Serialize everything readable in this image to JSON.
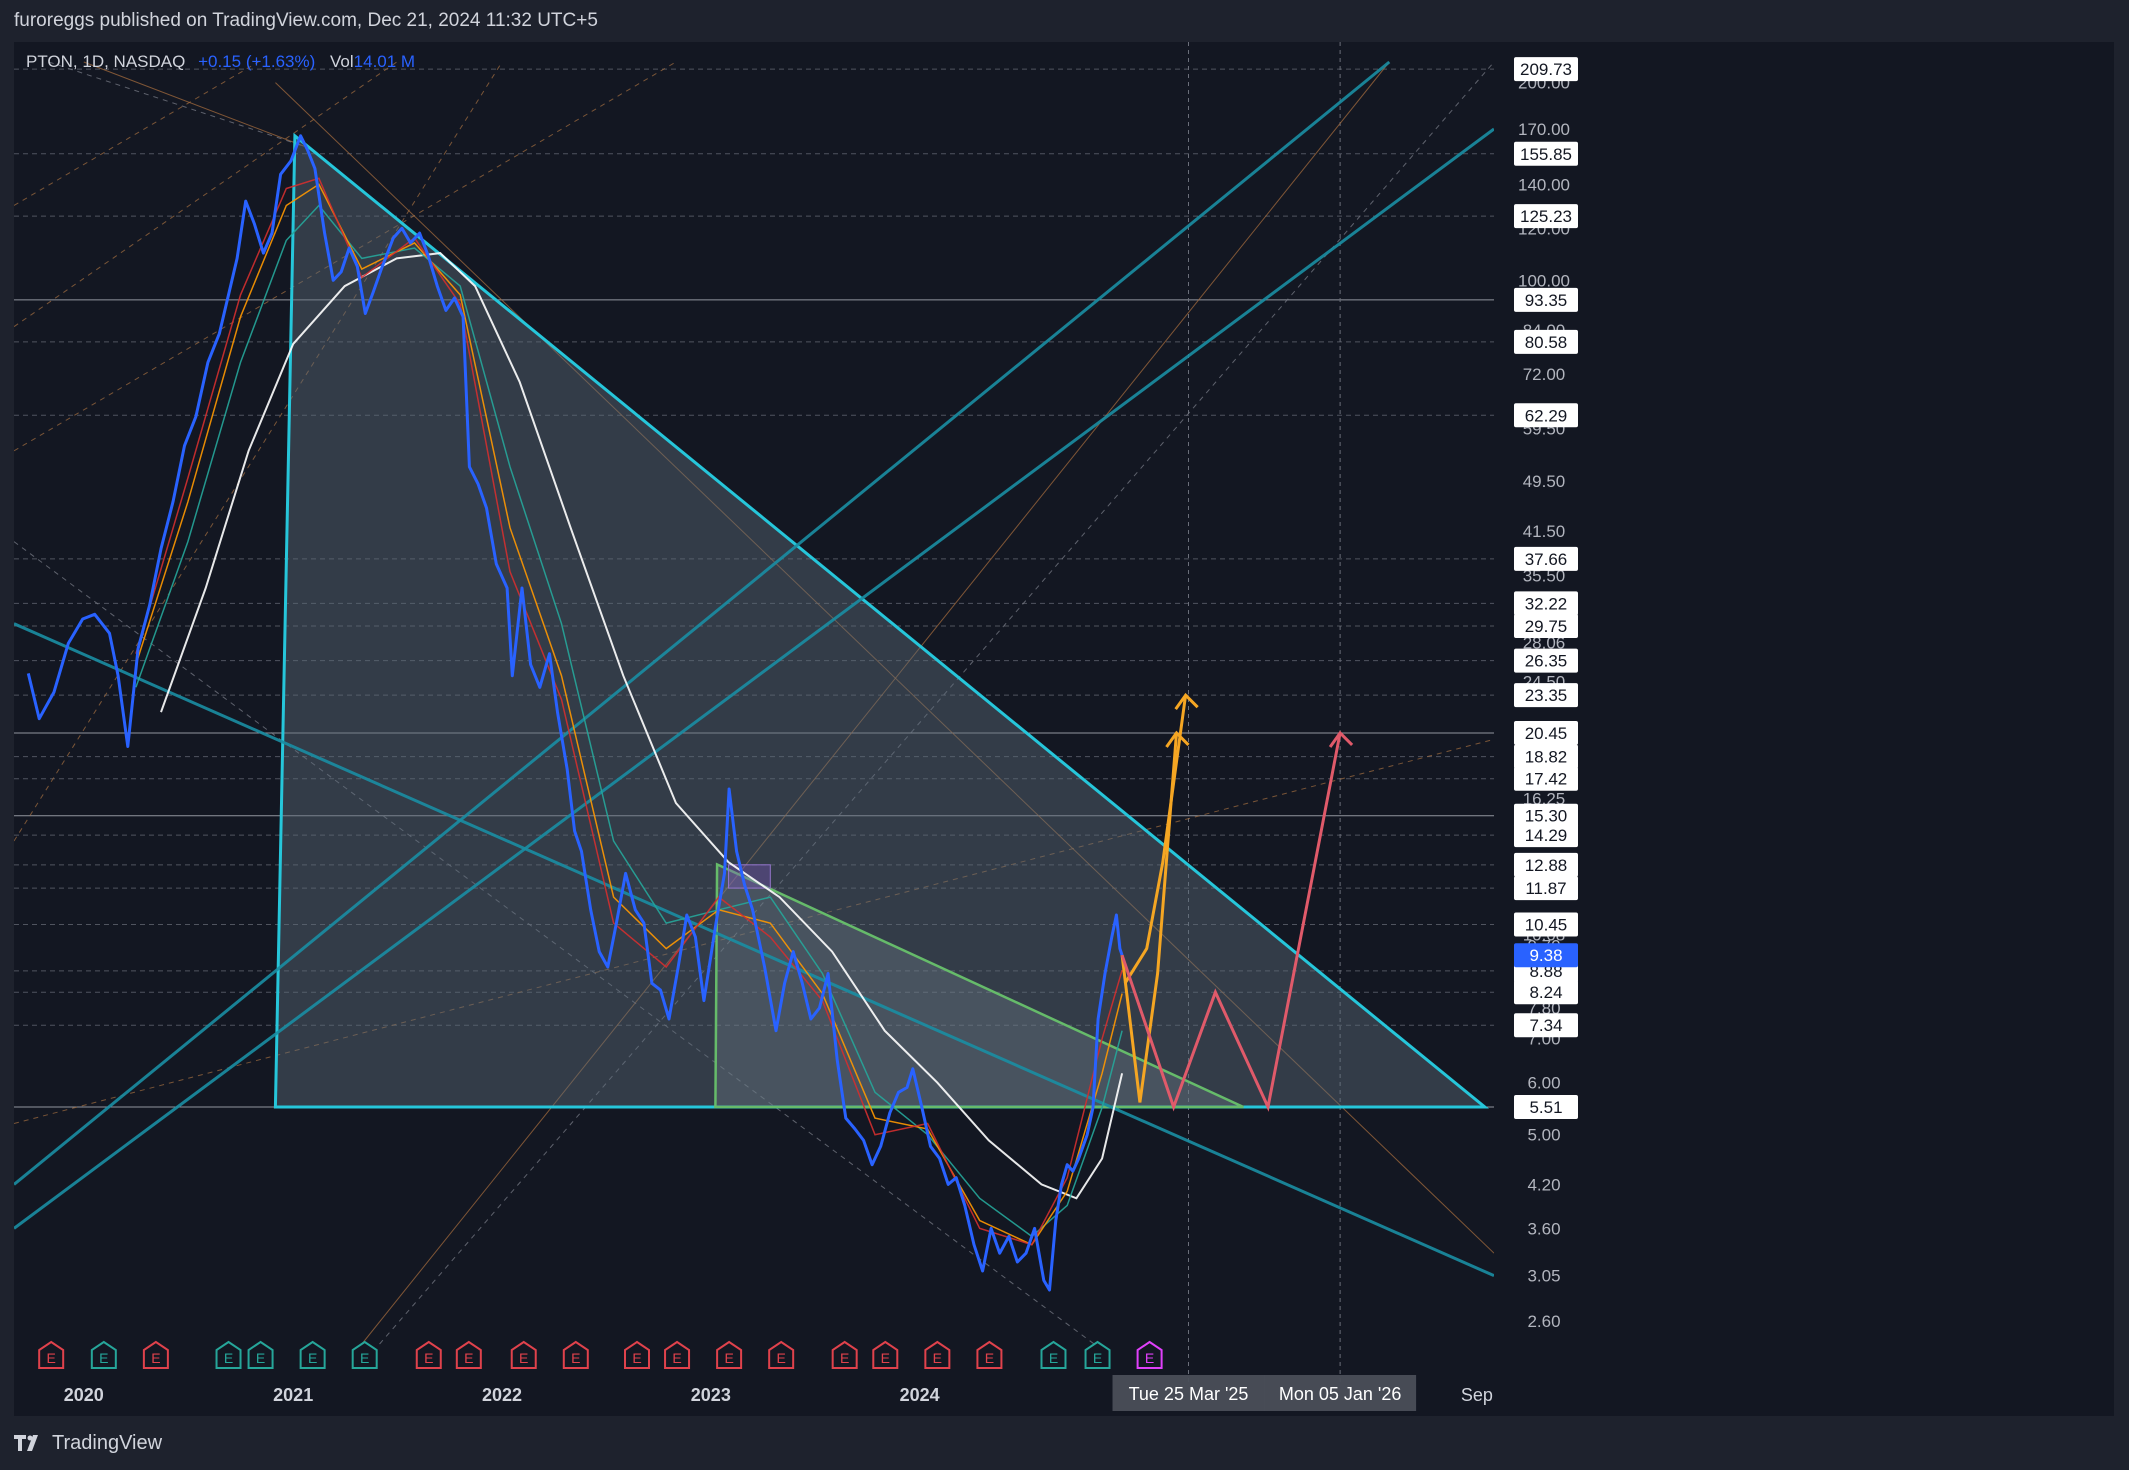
{
  "header": {
    "published": "furoreggs published on TradingView.com, Dec 21, 2024 11:32 UTC+5"
  },
  "legend": {
    "symbol": "PTON, 1D, NASDAQ",
    "change": "+0.15 (+1.63%)",
    "vol_label": "Vol",
    "vol_value": "14.01 M"
  },
  "footer": {
    "brand": "TradingView"
  },
  "colors": {
    "background": "#131722",
    "price": "#2962ff",
    "triangle": "#26c6da",
    "projection_up": "#f5a623",
    "projection_down": "#e05a6a",
    "earnings_red": "#e0424c",
    "earnings_green": "#26a69a",
    "earnings_purple": "#e040fb",
    "ma_white": "#ffffff",
    "ma_teal": "#26a69a",
    "ma_orange": "#ff9800",
    "ma_red": "#d32f2f"
  },
  "chart_data": {
    "type": "line",
    "symbol": "PTON",
    "interval": "1D",
    "y_scale": "log",
    "ylim": [
      2.4,
      215
    ],
    "x_range": [
      "2019-09-01",
      "2026-10-01"
    ],
    "x_tick_labels": [
      {
        "label": "2020",
        "date": "2020-01-01"
      },
      {
        "label": "2021",
        "date": "2021-01-01"
      },
      {
        "label": "2022",
        "date": "2022-01-01"
      },
      {
        "label": "2023",
        "date": "2023-01-01"
      },
      {
        "label": "2024",
        "date": "2024-01-01"
      },
      {
        "label": "Sep",
        "date": "2026-09-01"
      }
    ],
    "y_ticks": [
      200.0,
      170.0,
      140.0,
      120.0,
      100.0,
      84.0,
      72.0,
      59.5,
      49.5,
      41.5,
      35.5,
      28.06,
      24.5,
      16.25,
      10.08,
      9.7,
      7.8,
      7.0,
      6.0,
      5.0,
      4.2,
      3.6,
      3.05,
      2.6
    ],
    "y_level_labels": [
      209.73,
      155.85,
      125.23,
      93.35,
      80.58,
      62.29,
      37.66,
      32.22,
      29.75,
      26.35,
      23.35,
      20.45,
      18.82,
      17.42,
      15.3,
      14.29,
      12.88,
      11.87,
      10.45,
      8.88,
      8.24,
      7.34,
      5.51
    ],
    "current_price": 9.38,
    "date_badges": [
      "Tue 25 Mar '25",
      "Mon 05 Jan '26"
    ],
    "price_series": [
      [
        "2019-09-26",
        25.2
      ],
      [
        "2019-10-15",
        21.5
      ],
      [
        "2019-11-10",
        23.6
      ],
      [
        "2019-12-05",
        28.0
      ],
      [
        "2019-12-30",
        30.5
      ],
      [
        "2020-01-20",
        31.0
      ],
      [
        "2020-02-15",
        29.0
      ],
      [
        "2020-03-01",
        25.0
      ],
      [
        "2020-03-18",
        19.5
      ],
      [
        "2020-04-05",
        27.5
      ],
      [
        "2020-04-25",
        32.0
      ],
      [
        "2020-05-15",
        39.0
      ],
      [
        "2020-06-05",
        46.0
      ],
      [
        "2020-06-25",
        56.0
      ],
      [
        "2020-07-15",
        62.0
      ],
      [
        "2020-08-05",
        75.0
      ],
      [
        "2020-08-25",
        83.0
      ],
      [
        "2020-09-10",
        95.0
      ],
      [
        "2020-09-25",
        108.0
      ],
      [
        "2020-10-10",
        132.0
      ],
      [
        "2020-10-25",
        122.0
      ],
      [
        "2020-11-10",
        110.0
      ],
      [
        "2020-11-25",
        118.0
      ],
      [
        "2020-12-10",
        145.0
      ],
      [
        "2020-12-28",
        152.0
      ],
      [
        "2021-01-14",
        166.0
      ],
      [
        "2021-01-26",
        158.0
      ],
      [
        "2021-02-08",
        148.0
      ],
      [
        "2021-02-25",
        118.0
      ],
      [
        "2021-03-12",
        100.0
      ],
      [
        "2021-03-26",
        103.0
      ],
      [
        "2021-04-09",
        112.0
      ],
      [
        "2021-04-23",
        105.0
      ],
      [
        "2021-05-07",
        89.0
      ],
      [
        "2021-05-21",
        96.0
      ],
      [
        "2021-06-04",
        104.0
      ],
      [
        "2021-06-25",
        116.0
      ],
      [
        "2021-07-10",
        120.0
      ],
      [
        "2021-07-25",
        114.0
      ],
      [
        "2021-08-10",
        118.0
      ],
      [
        "2021-08-25",
        109.0
      ],
      [
        "2021-09-10",
        98.0
      ],
      [
        "2021-09-25",
        90.0
      ],
      [
        "2021-10-10",
        94.0
      ],
      [
        "2021-10-25",
        88.0
      ],
      [
        "2021-11-05",
        52.0
      ],
      [
        "2021-11-20",
        49.0
      ],
      [
        "2021-12-05",
        45.0
      ],
      [
        "2021-12-22",
        37.0
      ],
      [
        "2022-01-10",
        34.0
      ],
      [
        "2022-01-19",
        25.0
      ],
      [
        "2022-02-05",
        34.0
      ],
      [
        "2022-02-20",
        26.0
      ],
      [
        "2022-03-08",
        24.0
      ],
      [
        "2022-03-25",
        27.0
      ],
      [
        "2022-04-08",
        22.0
      ],
      [
        "2022-04-25",
        18.0
      ],
      [
        "2022-05-08",
        14.5
      ],
      [
        "2022-05-20",
        13.5
      ],
      [
        "2022-06-05",
        11.0
      ],
      [
        "2022-06-20",
        9.5
      ],
      [
        "2022-07-05",
        9.0
      ],
      [
        "2022-07-20",
        10.5
      ],
      [
        "2022-08-05",
        12.5
      ],
      [
        "2022-08-22",
        11.0
      ],
      [
        "2022-09-06",
        10.5
      ],
      [
        "2022-09-20",
        8.5
      ],
      [
        "2022-10-05",
        8.3
      ],
      [
        "2022-10-20",
        7.5
      ],
      [
        "2022-11-05",
        9.0
      ],
      [
        "2022-11-20",
        10.8
      ],
      [
        "2022-12-05",
        10.0
      ],
      [
        "2022-12-20",
        8.0
      ],
      [
        "2023-01-10",
        10.5
      ],
      [
        "2023-01-25",
        12.5
      ],
      [
        "2023-02-02",
        16.8
      ],
      [
        "2023-02-15",
        13.5
      ],
      [
        "2023-03-01",
        12.0
      ],
      [
        "2023-03-15",
        11.0
      ],
      [
        "2023-04-05",
        9.0
      ],
      [
        "2023-04-25",
        7.2
      ],
      [
        "2023-05-10",
        8.5
      ],
      [
        "2023-05-25",
        9.5
      ],
      [
        "2023-06-10",
        8.5
      ],
      [
        "2023-06-25",
        7.5
      ],
      [
        "2023-07-10",
        7.8
      ],
      [
        "2023-07-25",
        8.8
      ],
      [
        "2023-08-10",
        6.5
      ],
      [
        "2023-08-25",
        5.3
      ],
      [
        "2023-09-10",
        5.1
      ],
      [
        "2023-09-25",
        4.9
      ],
      [
        "2023-10-10",
        4.5
      ],
      [
        "2023-10-25",
        4.8
      ],
      [
        "2023-11-10",
        5.4
      ],
      [
        "2023-11-25",
        5.8
      ],
      [
        "2023-12-10",
        5.9
      ],
      [
        "2023-12-20",
        6.3
      ],
      [
        "2024-01-05",
        5.5
      ],
      [
        "2024-01-20",
        4.8
      ],
      [
        "2024-02-05",
        4.6
      ],
      [
        "2024-02-20",
        4.2
      ],
      [
        "2024-03-05",
        4.3
      ],
      [
        "2024-03-20",
        3.9
      ],
      [
        "2024-04-05",
        3.4
      ],
      [
        "2024-04-20",
        3.1
      ],
      [
        "2024-05-05",
        3.6
      ],
      [
        "2024-05-20",
        3.3
      ],
      [
        "2024-06-05",
        3.5
      ],
      [
        "2024-06-20",
        3.2
      ],
      [
        "2024-07-05",
        3.3
      ],
      [
        "2024-07-20",
        3.6
      ],
      [
        "2024-08-05",
        3.0
      ],
      [
        "2024-08-15",
        2.9
      ],
      [
        "2024-08-26",
        3.7
      ],
      [
        "2024-09-05",
        4.2
      ],
      [
        "2024-09-15",
        4.5
      ],
      [
        "2024-09-25",
        4.4
      ],
      [
        "2024-10-05",
        4.6
      ],
      [
        "2024-10-20",
        5.0
      ],
      [
        "2024-10-30",
        5.5
      ],
      [
        "2024-11-08",
        7.5
      ],
      [
        "2024-11-20",
        8.8
      ],
      [
        "2024-12-02",
        10.0
      ],
      [
        "2024-12-10",
        10.8
      ],
      [
        "2024-12-16",
        9.6
      ],
      [
        "2024-12-20",
        9.38
      ]
    ],
    "ma_white": [
      [
        "2020-05-15",
        22.0
      ],
      [
        "2020-08-01",
        34.0
      ],
      [
        "2020-10-15",
        55.0
      ],
      [
        "2021-01-01",
        80.0
      ],
      [
        "2021-04-01",
        98.0
      ],
      [
        "2021-07-01",
        108.0
      ],
      [
        "2021-09-15",
        110.0
      ],
      [
        "2021-11-15",
        98.0
      ],
      [
        "2022-02-01",
        70.0
      ],
      [
        "2022-05-01",
        42.0
      ],
      [
        "2022-08-01",
        25.0
      ],
      [
        "2022-11-01",
        16.0
      ],
      [
        "2023-02-01",
        13.0
      ],
      [
        "2023-05-01",
        11.5
      ],
      [
        "2023-08-01",
        9.5
      ],
      [
        "2023-11-01",
        7.2
      ],
      [
        "2024-02-01",
        6.0
      ],
      [
        "2024-05-01",
        4.9
      ],
      [
        "2024-08-01",
        4.2
      ],
      [
        "2024-10-01",
        4.0
      ],
      [
        "2024-11-15",
        4.6
      ],
      [
        "2024-12-20",
        6.2
      ]
    ],
    "ma_teal": [
      [
        "2020-04-01",
        24.0
      ],
      [
        "2020-07-01",
        40.0
      ],
      [
        "2020-10-01",
        75.0
      ],
      [
        "2020-12-20",
        115.0
      ],
      [
        "2021-02-15",
        130.0
      ],
      [
        "2021-05-01",
        108.0
      ],
      [
        "2021-08-01",
        112.0
      ],
      [
        "2021-10-20",
        98.0
      ],
      [
        "2022-01-15",
        52.0
      ],
      [
        "2022-04-15",
        30.0
      ],
      [
        "2022-07-15",
        14.0
      ],
      [
        "2022-10-15",
        10.5
      ],
      [
        "2023-01-15",
        11.0
      ],
      [
        "2023-04-15",
        11.5
      ],
      [
        "2023-07-15",
        8.8
      ],
      [
        "2023-10-15",
        5.8
      ],
      [
        "2024-01-15",
        5.0
      ],
      [
        "2024-04-15",
        4.0
      ],
      [
        "2024-07-15",
        3.5
      ],
      [
        "2024-09-15",
        3.9
      ],
      [
        "2024-11-15",
        5.5
      ],
      [
        "2024-12-20",
        7.2
      ]
    ],
    "ma_orange": [
      [
        "2020-04-01",
        26.0
      ],
      [
        "2020-07-01",
        46.0
      ],
      [
        "2020-10-01",
        88.0
      ],
      [
        "2020-12-20",
        130.0
      ],
      [
        "2021-02-15",
        140.0
      ],
      [
        "2021-05-01",
        104.0
      ],
      [
        "2021-08-01",
        114.0
      ],
      [
        "2021-10-20",
        95.0
      ],
      [
        "2022-01-15",
        42.0
      ],
      [
        "2022-04-15",
        25.0
      ],
      [
        "2022-07-15",
        11.5
      ],
      [
        "2022-10-15",
        9.6
      ],
      [
        "2023-01-15",
        11.0
      ],
      [
        "2023-04-15",
        10.5
      ],
      [
        "2023-07-15",
        8.2
      ],
      [
        "2023-10-15",
        5.3
      ],
      [
        "2024-01-15",
        5.1
      ],
      [
        "2024-04-15",
        3.7
      ],
      [
        "2024-07-15",
        3.4
      ],
      [
        "2024-09-15",
        4.1
      ],
      [
        "2024-11-15",
        6.2
      ],
      [
        "2024-12-20",
        8.2
      ]
    ],
    "ma_red": [
      [
        "2020-04-01",
        27.0
      ],
      [
        "2020-07-01",
        50.0
      ],
      [
        "2020-10-01",
        95.0
      ],
      [
        "2020-12-20",
        138.0
      ],
      [
        "2021-02-15",
        143.0
      ],
      [
        "2021-05-01",
        101.0
      ],
      [
        "2021-08-01",
        116.0
      ],
      [
        "2021-10-20",
        92.0
      ],
      [
        "2022-01-15",
        36.0
      ],
      [
        "2022-04-15",
        23.0
      ],
      [
        "2022-07-15",
        10.5
      ],
      [
        "2022-10-15",
        9.0
      ],
      [
        "2023-01-15",
        11.5
      ],
      [
        "2023-04-15",
        10.0
      ],
      [
        "2023-07-15",
        8.0
      ],
      [
        "2023-10-15",
        5.0
      ],
      [
        "2024-01-15",
        5.2
      ],
      [
        "2024-04-15",
        3.6
      ],
      [
        "2024-07-15",
        3.4
      ],
      [
        "2024-09-15",
        4.3
      ],
      [
        "2024-11-15",
        7.0
      ],
      [
        "2024-12-20",
        8.9
      ]
    ],
    "triangle_large": [
      [
        "2020-12-01",
        5.51
      ],
      [
        "2021-01-04",
        166.0
      ],
      [
        "2026-09-15",
        5.51
      ]
    ],
    "triangle_small": [
      [
        "2023-01-09",
        5.51
      ],
      [
        "2023-01-12",
        12.9
      ],
      [
        "2025-07-20",
        5.51
      ]
    ],
    "pattern_box": [
      [
        "2023-02-01",
        12.88
      ],
      [
        "2023-04-15",
        11.87
      ]
    ],
    "teal_trendlines": [
      [
        [
          "2019-09-01",
          4.2
        ],
        [
          "2026-04-01",
          215.0
        ]
      ],
      [
        [
          "2019-09-01",
          3.6
        ],
        [
          "2026-10-01",
          170.0
        ]
      ],
      [
        [
          "2019-09-01",
          30.0
        ],
        [
          "2026-10-01",
          3.05
        ]
      ]
    ],
    "thin_trendlines": [
      {
        "color": "#a46b3d",
        "dash": false,
        "pts": [
          [
            "2021-05-01",
            2.4
          ],
          [
            "2026-04-01",
            215.0
          ]
        ]
      },
      {
        "color": "#a46b3d",
        "dash": false,
        "pts": [
          [
            "2020-12-01",
            200.0
          ],
          [
            "2026-10-01",
            3.3
          ]
        ]
      },
      {
        "color": "#787b86",
        "dash": true,
        "pts": [
          [
            "2019-09-01",
            40.0
          ],
          [
            "2024-11-01",
            2.4
          ]
        ]
      },
      {
        "color": "#9c6a3f",
        "dash": true,
        "pts": [
          [
            "2019-09-01",
            5.2
          ],
          [
            "2026-10-01",
            20.0
          ]
        ]
      },
      {
        "color": "#787b86",
        "dash": true,
        "pts": [
          [
            "2021-06-01",
            2.4
          ],
          [
            "2026-10-01",
            215.0
          ]
        ]
      },
      {
        "color": "#9c6a3f",
        "dash": true,
        "pts": [
          [
            "2019-09-01",
            55.0
          ],
          [
            "2022-11-01",
            215.0
          ]
        ]
      },
      {
        "color": "#9c6a3f",
        "dash": true,
        "pts": [
          [
            "2019-09-01",
            85.0
          ],
          [
            "2021-07-01",
            215.0
          ]
        ]
      },
      {
        "color": "#9c6a3f",
        "dash": true,
        "pts": [
          [
            "2019-09-01",
            130.0
          ],
          [
            "2020-11-01",
            215.0
          ]
        ]
      },
      {
        "color": "#9c6a3f",
        "dash": true,
        "pts": [
          [
            "2019-09-01",
            14.0
          ],
          [
            "2022-01-01",
            215.0
          ]
        ]
      },
      {
        "color": "#a46b3d",
        "dash": false,
        "pts": [
          [
            "2020-01-01",
            215.0
          ],
          [
            "2021-01-20",
            160.0
          ]
        ]
      },
      {
        "color": "#787b86",
        "dash": true,
        "pts": [
          [
            "2019-11-01",
            215.0
          ],
          [
            "2021-01-20",
            160.0
          ]
        ]
      }
    ],
    "projection_up": [
      [
        [
          "2024-12-20",
          9.38
        ],
        [
          "2025-01-20",
          5.6
        ],
        [
          "2025-02-20",
          8.8
        ],
        [
          "2025-03-25",
          20.45
        ]
      ],
      [
        [
          "2024-12-25",
          8.5
        ],
        [
          "2025-02-01",
          9.6
        ],
        [
          "2025-03-01",
          13.0
        ],
        [
          "2025-04-10",
          23.35
        ]
      ]
    ],
    "projection_down": [
      [
        "2024-12-20",
        9.38
      ],
      [
        "2025-03-20",
        5.51
      ],
      [
        "2025-06-01",
        8.24
      ],
      [
        "2025-09-01",
        5.51
      ],
      [
        "2026-01-05",
        20.45
      ]
    ],
    "vlines_dotted": [
      "2025-04-15",
      "2026-01-05"
    ],
    "earnings": [
      {
        "d": "2019-11-05",
        "k": "R"
      },
      {
        "d": "2020-02-05",
        "k": "G"
      },
      {
        "d": "2020-05-06",
        "k": "R"
      },
      {
        "d": "2020-09-10",
        "k": "G"
      },
      {
        "d": "2020-11-05",
        "k": "G"
      },
      {
        "d": "2021-02-04",
        "k": "G"
      },
      {
        "d": "2021-05-06",
        "k": "G"
      },
      {
        "d": "2021-08-26",
        "k": "R"
      },
      {
        "d": "2021-11-04",
        "k": "R"
      },
      {
        "d": "2022-02-08",
        "k": "R"
      },
      {
        "d": "2022-05-10",
        "k": "R"
      },
      {
        "d": "2022-08-25",
        "k": "R"
      },
      {
        "d": "2022-11-03",
        "k": "R"
      },
      {
        "d": "2023-02-02",
        "k": "R"
      },
      {
        "d": "2023-05-04",
        "k": "R"
      },
      {
        "d": "2023-08-23",
        "k": "R"
      },
      {
        "d": "2023-11-02",
        "k": "R"
      },
      {
        "d": "2024-02-01",
        "k": "R"
      },
      {
        "d": "2024-05-02",
        "k": "R"
      },
      {
        "d": "2024-08-22",
        "k": "G"
      },
      {
        "d": "2024-11-07",
        "k": "G"
      },
      {
        "d": "2025-02-06",
        "k": "P"
      }
    ]
  }
}
